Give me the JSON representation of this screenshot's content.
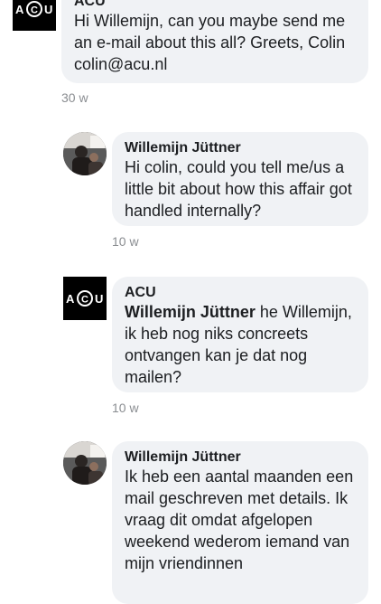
{
  "comments": [
    {
      "author": "ACU",
      "text": "Hi Willemijn, can you maybe send me an e-mail about this all? Greets, Colin colin@acu.nl",
      "time": "30 w",
      "avatar": "acu-logo"
    },
    {
      "author": "Willemijn Jüttner",
      "text": "Hi colin, could you tell me/us a little bit about how this affair got handled internally?",
      "time": "10 w",
      "avatar": "profile-photo"
    },
    {
      "author": "ACU",
      "mention": "Willemijn Jüttner",
      "text": " he Willemijn, ik heb nog niks concreets ontvangen kan je dat nog mailen?",
      "time": "10 w",
      "avatar": "acu-logo"
    },
    {
      "author": "Willemijn Jüttner",
      "text": "Ik heb een aantal maanden een mail geschreven met details. Ik vraag dit omdat afgelopen weekend wederom iemand van mijn vriendinnen",
      "avatar": "profile-photo"
    }
  ],
  "logo": {
    "text_left": "A",
    "text_center": "C",
    "text_right": "U"
  },
  "colors": {
    "bubble": "#f0f2f5",
    "timestamp": "#8a8d91",
    "logo_bg": "#000000"
  }
}
